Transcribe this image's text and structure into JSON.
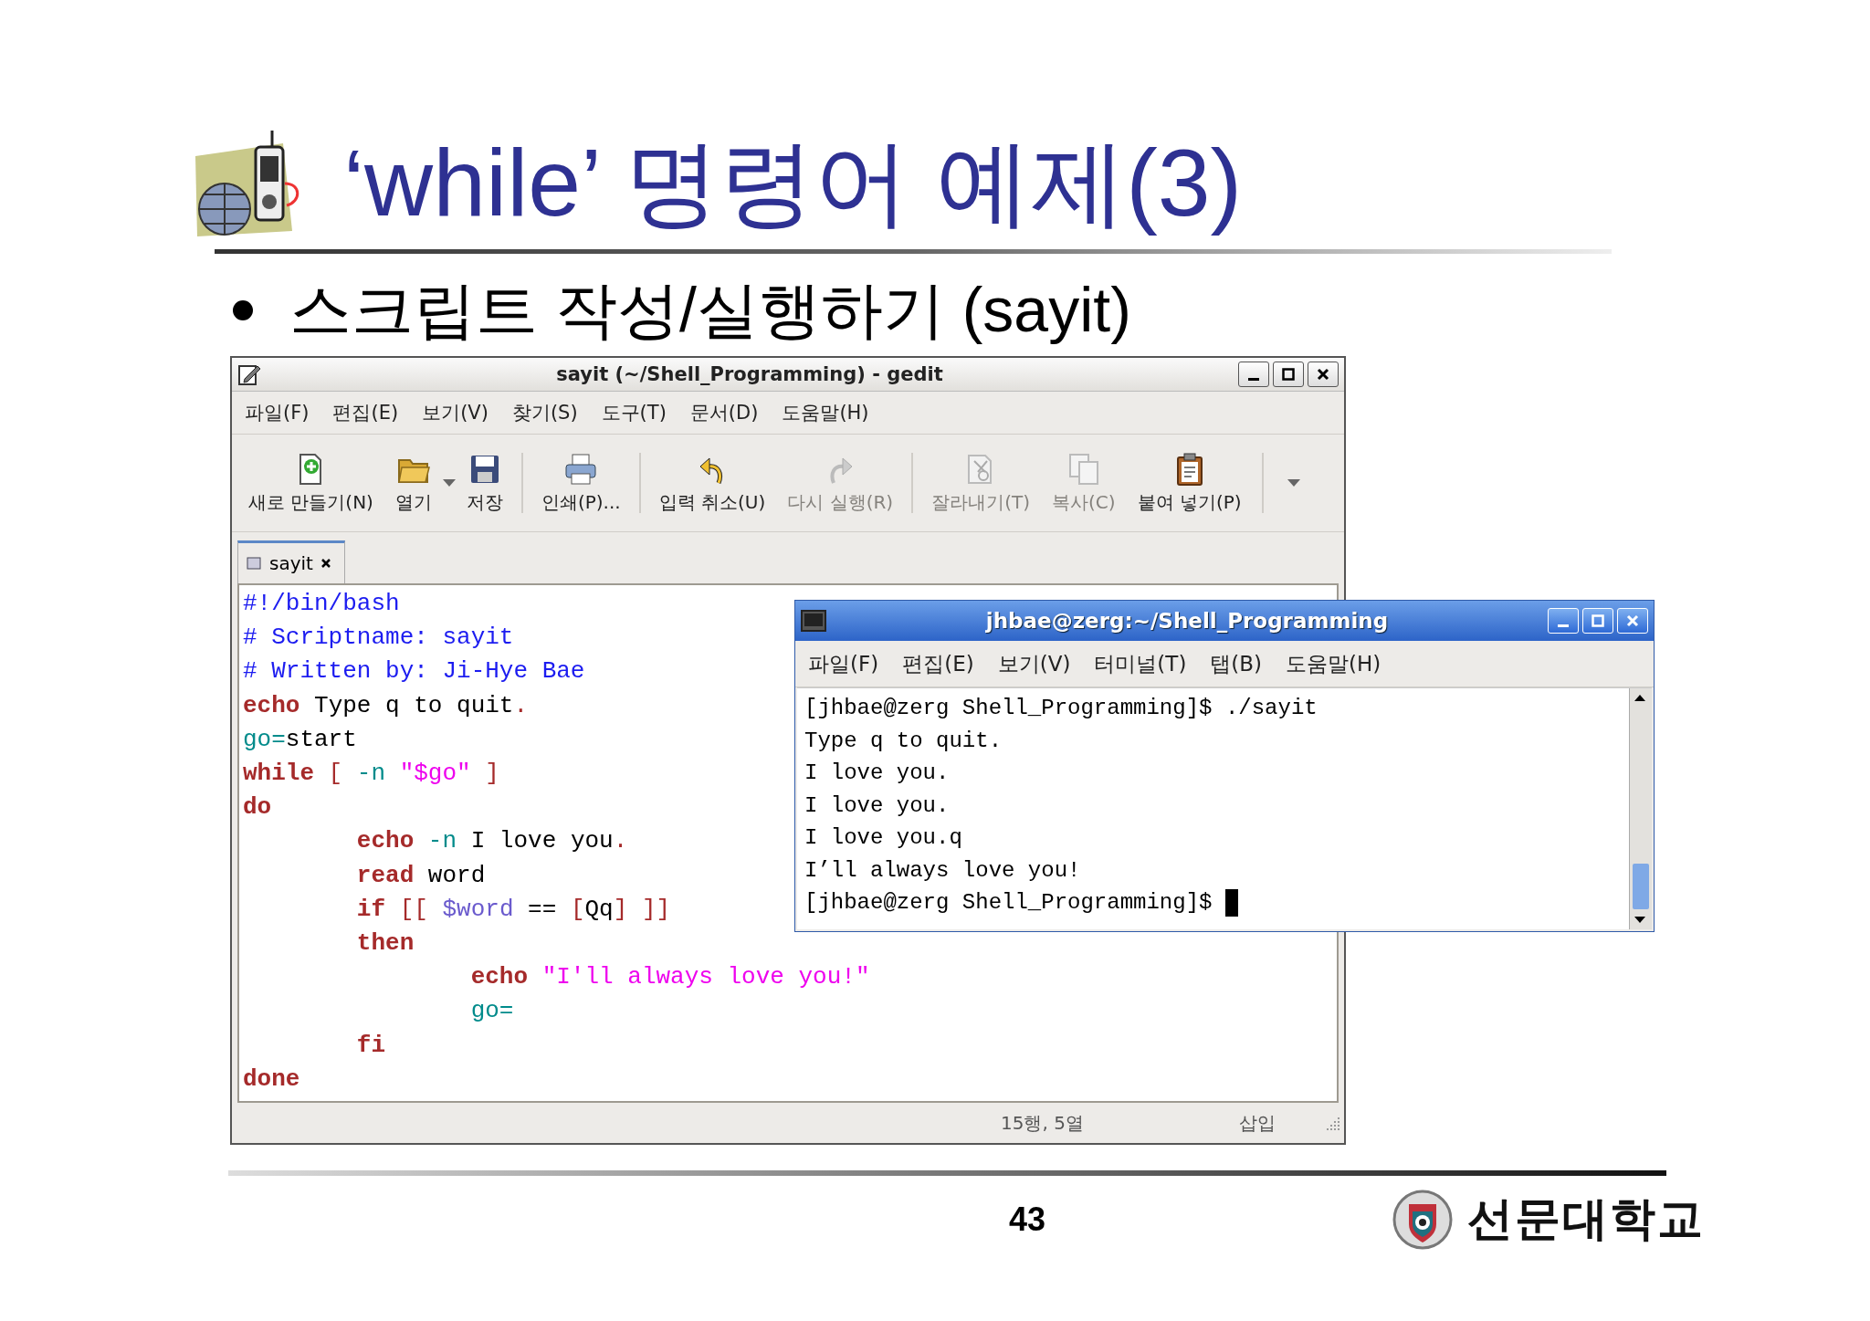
{
  "slide": {
    "title": "‘while’ 명령어 예제(3)",
    "bullet": "스크립트 작성/실행하기 (sayit)",
    "page_number": "43",
    "logo_text": "선문대학교"
  },
  "editor_window": {
    "title": "sayit (~/Shell_Programming) - gedit",
    "menu": [
      "파일(F)",
      "편집(E)",
      "보기(V)",
      "찾기(S)",
      "도구(T)",
      "문서(D)",
      "도움말(H)"
    ],
    "toolbar_groups": [
      [
        {
          "label": "새로 만들기(N)",
          "disabled": false,
          "has_menu": false
        },
        {
          "label": "열기",
          "disabled": false,
          "has_menu": true
        },
        {
          "label": "저장",
          "disabled": false,
          "has_menu": false
        }
      ],
      [
        {
          "label": "인쇄(P)...",
          "disabled": false,
          "has_menu": false
        }
      ],
      [
        {
          "label": "입력 취소(U)",
          "disabled": false,
          "has_menu": false
        },
        {
          "label": "다시 실행(R)",
          "disabled": true,
          "has_menu": false
        }
      ],
      [
        {
          "label": "잘라내기(T)",
          "disabled": true,
          "has_menu": false
        },
        {
          "label": "복사(C)",
          "disabled": true,
          "has_menu": false
        },
        {
          "label": "붙여 넣기(P)",
          "disabled": false,
          "has_menu": false
        }
      ]
    ],
    "tabs": [
      {
        "label": "sayit",
        "selected": true
      }
    ],
    "code_lines": [
      {
        "tokens": [
          {
            "kind": "comment",
            "text": "#!/bin/bash"
          }
        ]
      },
      {
        "tokens": [
          {
            "kind": "comment",
            "text": "# Scriptname: sayit"
          }
        ]
      },
      {
        "tokens": [
          {
            "kind": "comment",
            "text": "# Written by: Ji-Hye Bae"
          }
        ]
      },
      {
        "tokens": [
          {
            "kind": "keyword",
            "text": "echo"
          },
          {
            "kind": "plain",
            "text": " Type q to quit"
          },
          {
            "kind": "bracket",
            "text": "."
          }
        ]
      },
      {
        "tokens": [
          {
            "kind": "variable",
            "text": "go="
          },
          {
            "kind": "plain",
            "text": "start"
          }
        ]
      },
      {
        "tokens": [
          {
            "kind": "keyword",
            "text": "while"
          },
          {
            "kind": "bracket",
            "text": " [ "
          },
          {
            "kind": "variable",
            "text": "-n"
          },
          {
            "kind": "string",
            "text": " \"$go\""
          },
          {
            "kind": "bracket",
            "text": " ]"
          }
        ]
      },
      {
        "tokens": [
          {
            "kind": "keyword",
            "text": "do"
          }
        ]
      },
      {
        "tokens": [
          {
            "kind": "keyword",
            "text": "\techo"
          },
          {
            "kind": "variable",
            "text": " -n"
          },
          {
            "kind": "plain",
            "text": " I love you"
          },
          {
            "kind": "bracket",
            "text": "."
          }
        ]
      },
      {
        "tokens": [
          {
            "kind": "keyword",
            "text": "\tread"
          },
          {
            "kind": "plain",
            "text": " word"
          }
        ]
      },
      {
        "tokens": [
          {
            "kind": "keyword",
            "text": "\tif"
          },
          {
            "kind": "bracket",
            "text": " [[ "
          },
          {
            "kind": "reference",
            "text": "$word"
          },
          {
            "kind": "plain",
            "text": " == "
          },
          {
            "kind": "bracket",
            "text": "["
          },
          {
            "kind": "plain",
            "text": "Qq"
          },
          {
            "kind": "bracket",
            "text": "] ]]"
          }
        ]
      },
      {
        "tokens": [
          {
            "kind": "keyword",
            "text": "\tthen"
          }
        ]
      },
      {
        "tokens": [
          {
            "kind": "keyword",
            "text": "\t\techo"
          },
          {
            "kind": "string",
            "text": " \"I'll always love you!\""
          }
        ]
      },
      {
        "tokens": [
          {
            "kind": "variable",
            "text": "\t\tgo="
          }
        ]
      },
      {
        "tokens": [
          {
            "kind": "keyword",
            "text": "\tfi"
          }
        ]
      },
      {
        "tokens": [
          {
            "kind": "keyword",
            "text": "done"
          }
        ]
      }
    ],
    "status": {
      "position": "15행, 5열",
      "mode": "삽입"
    }
  },
  "terminal_window": {
    "title": "jhbae@zerg:~/Shell_Programming",
    "menu": [
      "파일(F)",
      "편집(E)",
      "보기(V)",
      "터미널(T)",
      "탭(B)",
      "도움말(H)"
    ],
    "lines": [
      "[jhbae@zerg Shell_Programming]$ ./sayit",
      "Type q to quit.",
      "I love you.",
      "I love you.",
      "I love you.q",
      "I’ll always love you!",
      "[jhbae@zerg Shell_Programming]$ "
    ],
    "cursor_visible": true
  }
}
